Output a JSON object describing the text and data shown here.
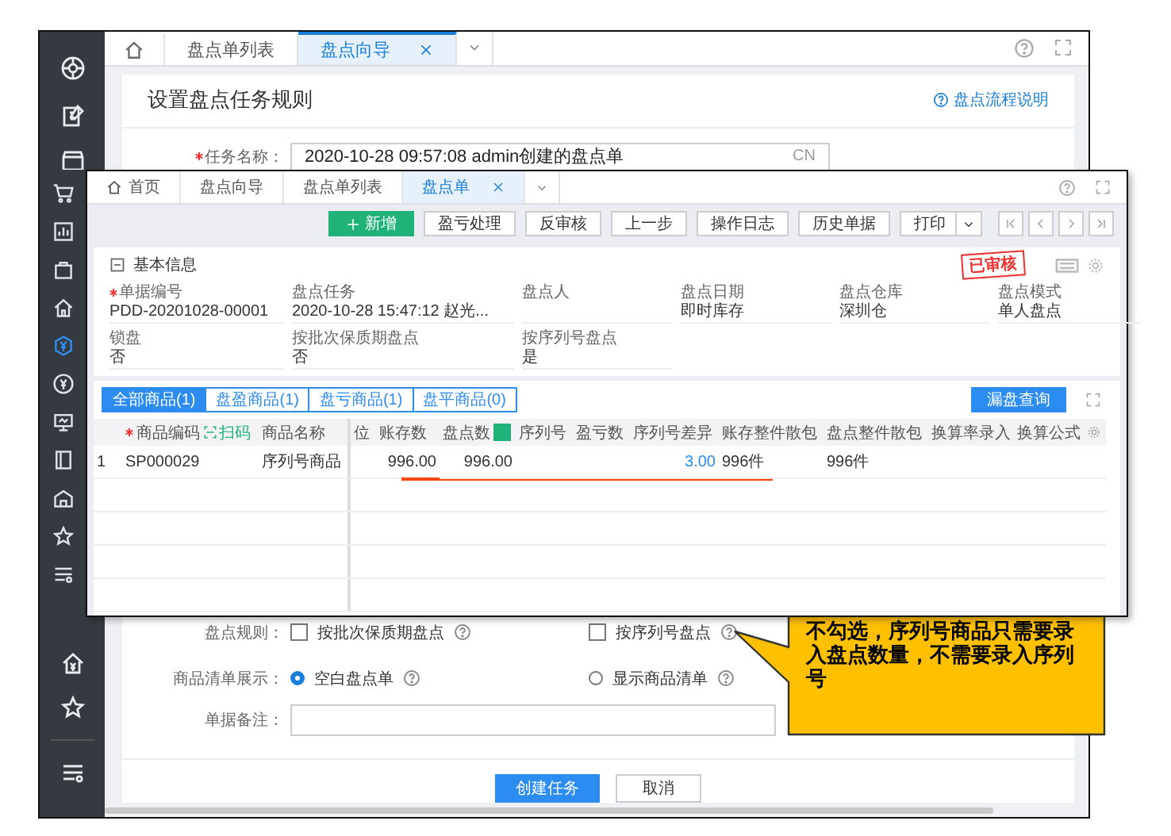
{
  "outer": {
    "tabs": [
      {
        "label": "盘点单列表",
        "selected": false,
        "closable": false
      },
      {
        "label": "盘点向导",
        "selected": true,
        "closable": true
      }
    ],
    "title": "设置盘点任务规则",
    "help_link": "盘点流程说明",
    "task_name": {
      "label": "任务名称：",
      "required": true,
      "value": "2020-10-28 09:57:08  admin创建的盘点单",
      "suffix": "CN"
    },
    "rules": {
      "label": "盘点规则：",
      "options": [
        {
          "label": "按批次保质期盘点",
          "checked": false
        },
        {
          "label": "按序列号盘点",
          "checked": false
        }
      ]
    },
    "list_display": {
      "label": "商品清单展示：",
      "options": [
        {
          "label": "空白盘点单",
          "selected": true
        },
        {
          "label": "显示商品清单",
          "selected": false
        }
      ]
    },
    "remark": {
      "label": "单据备注："
    },
    "buttons": [
      {
        "label": "创建任务",
        "kind": "primary"
      },
      {
        "label": "取消",
        "kind": "default"
      }
    ]
  },
  "inner": {
    "tabs": [
      {
        "label": "首页",
        "kind": "home",
        "selected": false,
        "closable": false
      },
      {
        "label": "盘点向导",
        "kind": "page",
        "selected": false,
        "closable": false
      },
      {
        "label": "盘点单列表",
        "kind": "page",
        "selected": false,
        "closable": false
      },
      {
        "label": "盘点单",
        "kind": "page",
        "selected": true,
        "closable": true
      }
    ],
    "toolbar": [
      {
        "label": "新增",
        "kind": "primary"
      },
      {
        "label": "盈亏处理",
        "kind": "default"
      },
      {
        "label": "反审核",
        "kind": "default"
      },
      {
        "label": "上一步",
        "kind": "default"
      },
      {
        "label": "操作日志",
        "kind": "default"
      },
      {
        "label": "历史单据",
        "kind": "default"
      },
      {
        "label": "打印",
        "kind": "split"
      }
    ],
    "section_title": "基本信息",
    "stamp": "已审核",
    "fields": [
      {
        "label": "单据编号",
        "value": "PDD-20201028-00001",
        "required": true
      },
      {
        "label": "盘点任务",
        "value": "2020-10-28 15:47:12  赵光...",
        "required": false
      },
      {
        "label": "盘点人",
        "required": false
      },
      {
        "label": "盘点日期",
        "value": "即时库存",
        "required": false
      },
      {
        "label": "盘点仓库",
        "value": "深圳仓",
        "required": false
      },
      {
        "label": "盘点模式",
        "value": "单人盘点",
        "required": false
      },
      {
        "label": "锁盘",
        "value": "否",
        "required": false
      },
      {
        "label": "按批次保质期盘点",
        "value": "否",
        "required": false
      },
      {
        "label": "按序列号盘点",
        "value": "是",
        "required": false
      }
    ],
    "filter_tabs": [
      {
        "label": "全部商品(1)",
        "selected": true
      },
      {
        "label": "盘盈商品(1)",
        "selected": false
      },
      {
        "label": "盘亏商品(1)",
        "selected": false
      },
      {
        "label": "盘平商品(0)",
        "selected": false
      }
    ],
    "query_button": "漏盘查询",
    "columns": [
      {
        "label": "商品编码",
        "kind": "text",
        "required": true,
        "scan_label": "扫码"
      },
      {
        "label": "商品名称",
        "kind": "text"
      },
      {
        "label": "位",
        "kind": "text"
      },
      {
        "label": "账存数",
        "kind": "number"
      },
      {
        "label": "盘点数",
        "kind": "number",
        "checked": true
      },
      {
        "label": "序列号",
        "kind": "text"
      },
      {
        "label": "盈亏数",
        "kind": "number"
      },
      {
        "label": "序列号差异",
        "kind": "link"
      },
      {
        "label": "账存整件散包",
        "kind": "text"
      },
      {
        "label": "盘点整件散包",
        "kind": "text"
      },
      {
        "label": "换算率录入",
        "kind": "text"
      },
      {
        "label": "换算公式",
        "kind": "text"
      }
    ],
    "rows": [
      {
        "index": "1",
        "cells": [
          "SP000029",
          "序列号商品",
          null,
          "996.00",
          "996.00",
          null,
          null,
          "3.00",
          "996件",
          "996件",
          null,
          null
        ]
      }
    ]
  },
  "callout": "不勾选，序列号商品只需要录入盘点数量，不需要录入序列号"
}
